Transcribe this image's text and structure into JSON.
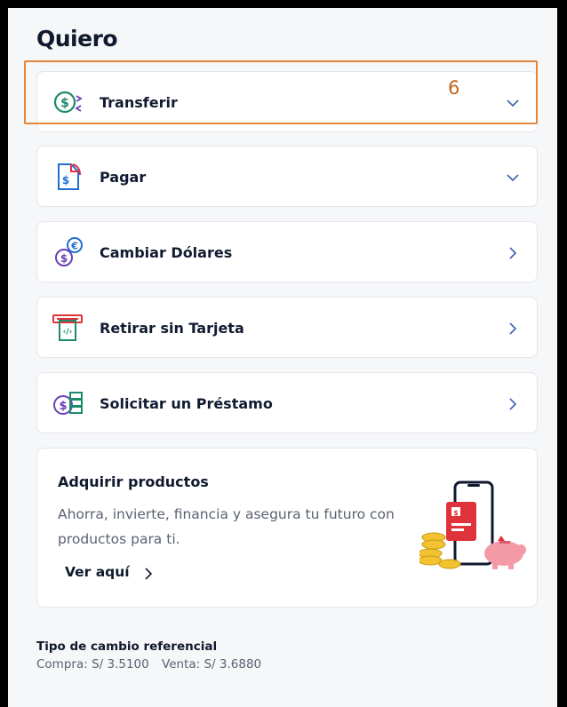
{
  "header": {
    "title": "Quiero"
  },
  "menu": {
    "items": [
      {
        "label": "Transferir",
        "indicator": "chevron-down",
        "icon": "transfer-money-icon"
      },
      {
        "label": "Pagar",
        "indicator": "chevron-down",
        "icon": "bill-payment-icon"
      },
      {
        "label": "Cambiar Dólares",
        "indicator": "chevron-right",
        "icon": "currency-exchange-icon"
      },
      {
        "label": "Retirar sin Tarjeta",
        "indicator": "chevron-right",
        "icon": "cardless-withdrawal-icon"
      },
      {
        "label": "Solicitar un Préstamo",
        "indicator": "chevron-right",
        "icon": "loan-icon"
      }
    ]
  },
  "annotation": {
    "badge": "6",
    "color": "#e1873c"
  },
  "promo": {
    "title": "Adquirir productos",
    "description": "Ahorra, invierte, financia y asegura tu futuro con productos para ti.",
    "link_label": "Ver aquí"
  },
  "exchange": {
    "title": "Tipo de cambio referencial",
    "compra": "Compra: S/ 3.5100",
    "venta": "Venta: S/ 3.6880"
  },
  "colors": {
    "transfer_green": "#1e8a6a",
    "pay_blue": "#1f6fd1",
    "purple": "#6a3fb8",
    "red": "#e0323a",
    "text": "#10192e"
  }
}
